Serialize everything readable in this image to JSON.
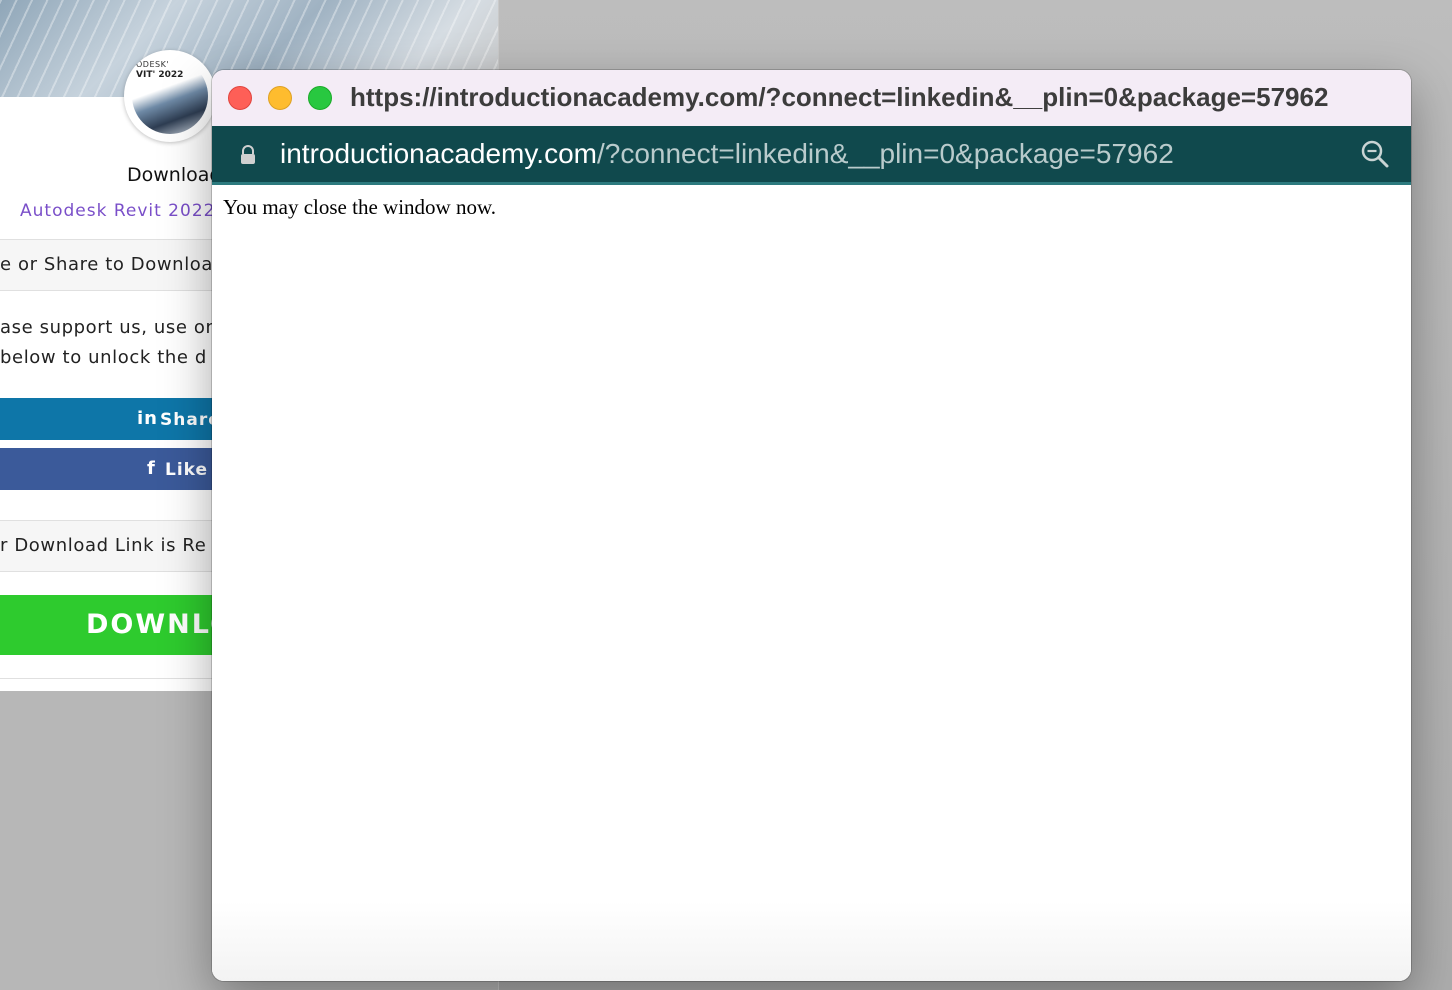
{
  "background_page": {
    "logo": {
      "line1": "ODESK'",
      "line2": "VIT' 2022"
    },
    "title": "Download",
    "subtitle": "Autodesk Revit 2022",
    "like_share_heading": "e or Share to Download",
    "support_line1": "ase support us, use on",
    "support_line2": "below to unlock the d",
    "linkedin_button": "Share",
    "facebook_button": "Like",
    "link_ready_heading": "r Download Link is Re",
    "download_button": "DOWNLO"
  },
  "popup": {
    "title_url": "https://introductionacademy.com/?connect=linkedin&__plin=0&package=57962",
    "address_host": "introductionacademy.com",
    "address_path": "/?connect=linkedin&__plin=0&package=57962",
    "body_text": "You may close the window now."
  },
  "colors": {
    "linkedin": "#0e76a8",
    "facebook": "#3b5a9a",
    "download": "#2ecb2e",
    "addressbar": "#10494d",
    "subtitle": "#7a4fc9"
  }
}
